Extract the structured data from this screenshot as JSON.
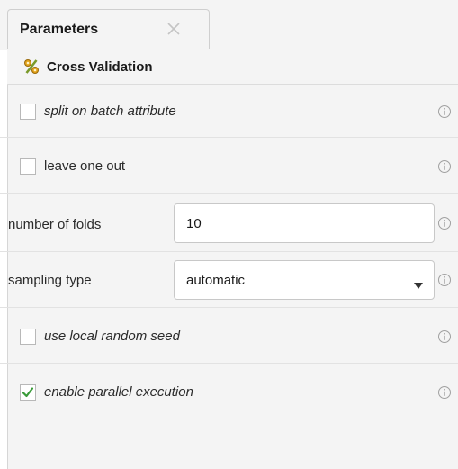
{
  "tab": {
    "label": "Parameters",
    "close_icon": "close-icon"
  },
  "operator": {
    "icon": "cross-validation-icon",
    "title": "Cross Validation"
  },
  "parameters": {
    "split_on_batch": {
      "label": "split on batch attribute",
      "checked": false
    },
    "leave_one_out": {
      "label": "leave one out",
      "checked": false
    },
    "number_of_folds": {
      "label": "number of folds",
      "value": "10"
    },
    "sampling_type": {
      "label": "sampling type",
      "value": "automatic"
    },
    "use_local_random_seed": {
      "label": "use local random seed",
      "checked": false
    },
    "enable_parallel_execution": {
      "label": "enable parallel execution",
      "checked": true
    }
  },
  "icons": {
    "info": "info-icon",
    "dropdown": "chevron-down-icon",
    "check": "checkmark-icon"
  },
  "colors": {
    "panel_bg": "#f4f4f4",
    "checkmark": "#3a9b3a",
    "operator_icon_primary": "#e2a21b",
    "operator_icon_secondary": "#7a9a2a"
  }
}
